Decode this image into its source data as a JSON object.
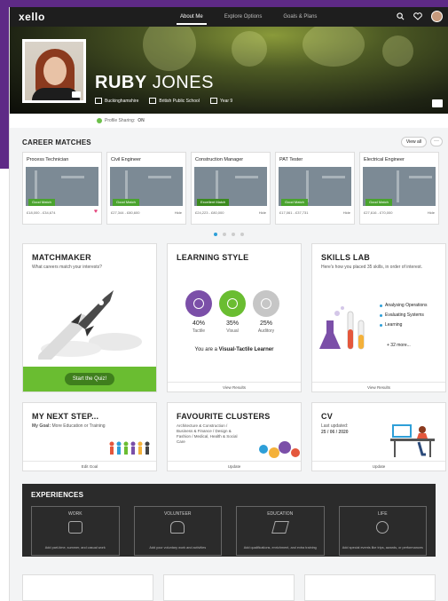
{
  "nav": {
    "logo": "xello",
    "links": [
      "About Me",
      "Explore Options",
      "Goals & Plans"
    ],
    "active_index": 0
  },
  "profile": {
    "first_name": "RUBY",
    "last_name": "JONES",
    "location": "Buckinghamshire",
    "school": "British Public School",
    "year": "Year 9",
    "sharing_label": "Profile Sharing:",
    "sharing_value": "ON"
  },
  "career_matches": {
    "title": "CAREER MATCHES",
    "view_all": "View all",
    "more": "···",
    "cards": [
      {
        "title": "Process Technician",
        "badge": "Good Match",
        "badge_color": "#4aa32e",
        "salary": "£18,000 - £34,674",
        "favourited": true
      },
      {
        "title": "Civil Engineer",
        "badge": "Good Match",
        "badge_color": "#4aa32e",
        "salary": "£27,344 - £80,600",
        "extra": "Hide"
      },
      {
        "title": "Construction Manager",
        "badge": "Excellent Match",
        "badge_color": "#3b8a1e",
        "salary": "£24,223 - £80,000",
        "extra": "Hide"
      },
      {
        "title": "PAT Tester",
        "badge": "Good Match",
        "badge_color": "#4aa32e",
        "salary": "£17,061 - £37,731",
        "extra": "Hide"
      },
      {
        "title": "Electrical Engineer",
        "badge": "Good Match",
        "badge_color": "#4aa32e",
        "salary": "£27,616 - £70,000",
        "extra": "Hide"
      }
    ],
    "page_count": 4,
    "active_page": 0
  },
  "matchmaker": {
    "title": "MATCHMAKER",
    "subtitle": "What careers match your interests?",
    "button": "Start the Quiz!"
  },
  "learning_style": {
    "title": "LEARNING STYLE",
    "items": [
      {
        "pct": "40%",
        "label": "Tactile",
        "color": "#7b4fa8"
      },
      {
        "pct": "35%",
        "label": "Visual",
        "color": "#6abd31"
      },
      {
        "pct": "25%",
        "label": "Auditory",
        "color": "#c6c6c6"
      }
    ],
    "result_prefix": "You are a",
    "result_bold": "Visual-Tactile Learner",
    "footer": "View Results"
  },
  "skills_lab": {
    "title": "SKILLS LAB",
    "subtitle": "Here's how you placed 35 skills, in order of interest.",
    "skills": [
      "Analysing Operations",
      "Evaluating Systems",
      "Learning"
    ],
    "more": "+ 32 more...",
    "footer": "View Results"
  },
  "next_step": {
    "title": "MY NEXT STEP...",
    "goal_label": "My Goal:",
    "goal_value": "More Education or Training",
    "footer": "Edit Goal"
  },
  "clusters": {
    "title": "FAVOURITE CLUSTERS",
    "text": "Architecture & Construction / Business & Finance / Design & Fashion / Medical, Health & Social Care",
    "footer": "Update"
  },
  "cv": {
    "title": "CV",
    "updated_label": "Last updated:",
    "updated_date": "25 / 06 / 2020",
    "footer": "Update"
  },
  "experiences": {
    "title": "EXPERIENCES",
    "cards": [
      {
        "label": "WORK",
        "icon": "briefcase-icon",
        "desc": "Add part-time, summer, and casual work"
      },
      {
        "label": "VOLUNTEER",
        "icon": "hand-icon",
        "desc": "Add your voluntary work and activities"
      },
      {
        "label": "EDUCATION",
        "icon": "graduation-cap-icon",
        "desc": "Add qualifications, enrichment, and extra training"
      },
      {
        "label": "LIFE",
        "icon": "checkmark-icon",
        "desc": "Add special events like trips, awards, or performances"
      }
    ]
  }
}
